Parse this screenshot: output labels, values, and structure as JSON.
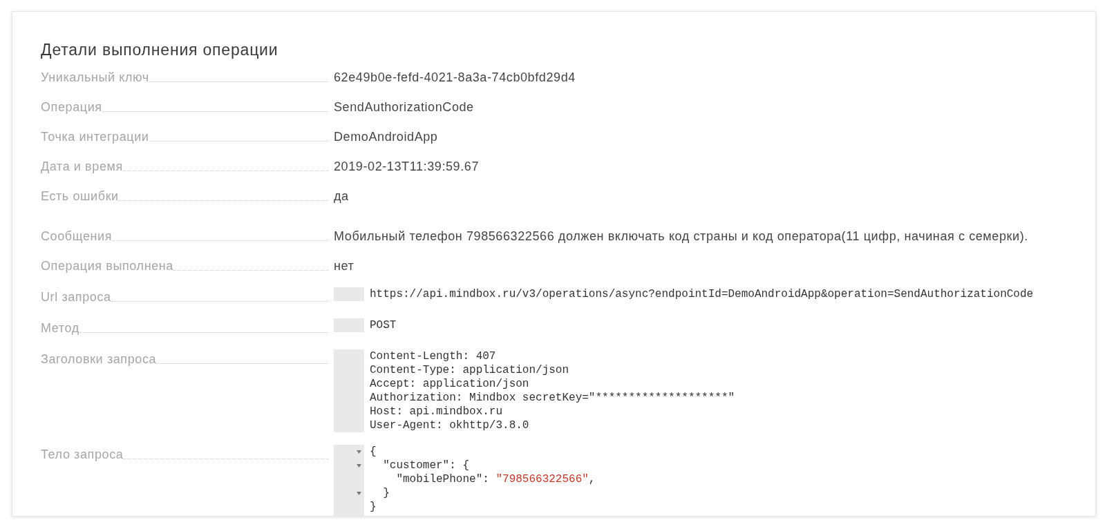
{
  "title": "Детали выполнения операции",
  "sections": [
    {
      "rows": [
        {
          "kind": "text",
          "label": "Уникальный ключ",
          "value": "62e49b0e-fefd-4021-8a3a-74cb0bfd29d4"
        },
        {
          "kind": "text",
          "label": "Операция",
          "value": "SendAuthorizationCode"
        },
        {
          "kind": "text",
          "label": "Точка интеграции",
          "value": "DemoAndroidApp"
        },
        {
          "kind": "text",
          "label": "Дата и время",
          "value": "2019-02-13T11:39:59.67"
        },
        {
          "kind": "text",
          "label": "Есть ошибки",
          "value": "да"
        }
      ]
    },
    {
      "rows": [
        {
          "kind": "text",
          "label": "Сообщения",
          "value": "Мобильный телефон 798566322566 должен включать код страны и код оператора(11 цифр, начиная с семерки)."
        },
        {
          "kind": "text",
          "label": "Операция выполнена",
          "value": "нет"
        },
        {
          "kind": "code",
          "label": "Url запроса",
          "lines": [
            "https://api.mindbox.ru/v3/operations/async?endpointId=DemoAndroidApp&operation=SendAuthorizationCode"
          ]
        },
        {
          "kind": "code",
          "label": "Метод",
          "lines": [
            "POST"
          ]
        },
        {
          "kind": "code",
          "label": "Заголовки запроса",
          "lines": [
            "Content-Length: 407",
            "Content-Type: application/json",
            "Accept: application/json",
            "Authorization: Mindbox secretKey=\"********************\"",
            "Host: api.mindbox.ru",
            "User-Agent: okhttp/3.8.0"
          ]
        },
        {
          "kind": "json",
          "label": "Тело запроса",
          "lines": [
            {
              "expanded": true,
              "tokens": [
                {
                  "kind": "plain",
                  "text": "{"
                }
              ]
            },
            {
              "expanded": true,
              "tokens": [
                {
                  "kind": "plain",
                  "text": "  \"customer\": {"
                }
              ]
            },
            {
              "tokens": [
                {
                  "kind": "plain",
                  "text": "    \"mobilePhone\": "
                },
                {
                  "kind": "string",
                  "text": "\"798566322566\""
                },
                {
                  "kind": "plain",
                  "text": ","
                }
              ]
            },
            {
              "expanded": true,
              "tokens": [
                {
                  "kind": "plain",
                  "text": "  }"
                }
              ]
            },
            {
              "tokens": [
                {
                  "kind": "plain",
                  "text": "}"
                }
              ]
            }
          ]
        }
      ]
    }
  ]
}
